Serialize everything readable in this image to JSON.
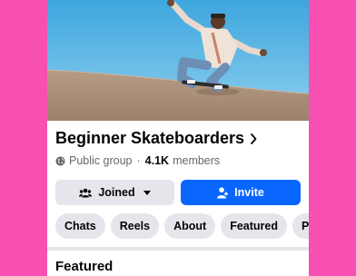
{
  "group": {
    "name": "Beginner Skateboarders",
    "privacy": "Public group",
    "separator": "·",
    "member_count": "4.1K",
    "members_label": "members"
  },
  "actions": {
    "joined_label": "Joined",
    "invite_label": "Invite"
  },
  "tabs": [
    "Chats",
    "Reels",
    "About",
    "Featured",
    "Photos"
  ],
  "featured": {
    "title": "Featured"
  },
  "colors": {
    "background": "#F74FB2",
    "primary": "#0866FF",
    "secondary_button": "#E4E6EB",
    "text": "#050505",
    "muted_text": "#65676B"
  },
  "icons": {
    "cover": "cover-photo",
    "chevron": "chevron-right-icon",
    "globe": "globe-icon",
    "joined": "people-icon",
    "joined_caret": "caret-down-icon",
    "invite": "add-person-icon"
  }
}
